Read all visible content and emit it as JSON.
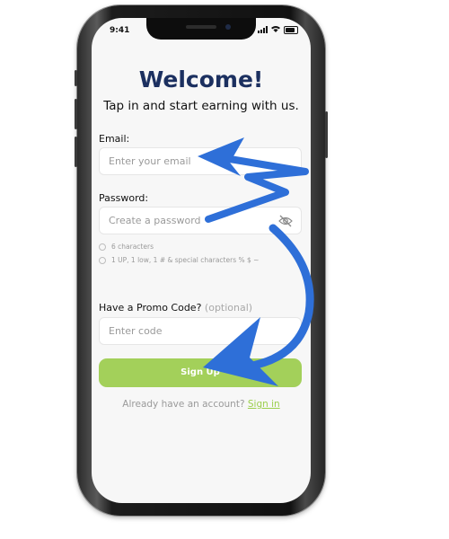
{
  "status_bar": {
    "time": "9:41"
  },
  "header": {
    "title": "Welcome!",
    "subtitle": "Tap in and start earning with us."
  },
  "form": {
    "email_label": "Email:",
    "email_placeholder": "Enter your email",
    "password_label": "Password:",
    "password_placeholder": "Create a password",
    "password_rules": [
      "6 characters",
      "1 UP, 1 low, 1 # & special characters % $ ~"
    ],
    "promo_label": "Have a Promo Code?",
    "promo_optional": "(optional)",
    "promo_placeholder": "Enter code",
    "signup_label": "Sign Up"
  },
  "footer": {
    "already_text": "Already have an account?",
    "signin_label": "Sign in"
  },
  "colors": {
    "title": "#1c3060",
    "accent_green": "#a3d05a",
    "annotation_blue": "#2e6fd8"
  },
  "icons": [
    "eye-slash-icon",
    "signal-icon",
    "wifi-icon",
    "battery-icon"
  ]
}
